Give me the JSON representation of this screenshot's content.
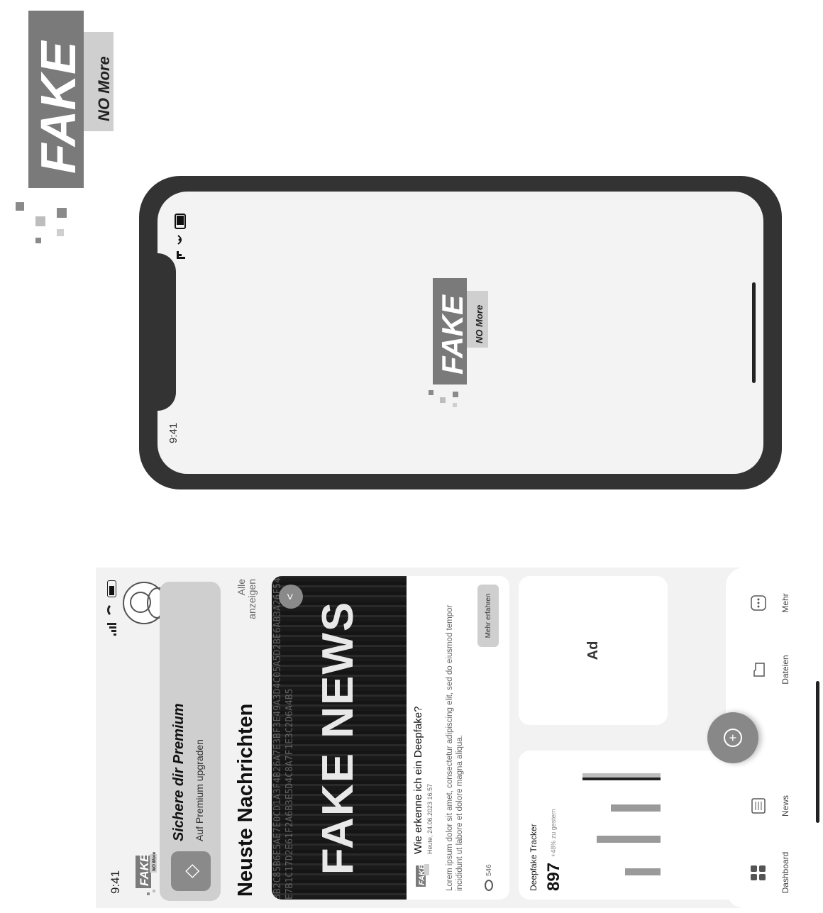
{
  "brand": {
    "word": "FAKE",
    "tagline": "NO More"
  },
  "splash": {
    "time": "9:41"
  },
  "app": {
    "status_time": "9:41",
    "premium": {
      "title": "Sichere dir Premium",
      "subtitle": "Auf Premium upgraden"
    },
    "news_section": {
      "title": "Neuste Nachrichten",
      "see_all": "Alle anzeigen"
    },
    "news_card": {
      "image_text": "FAKE NEWS",
      "heading": "Wie erkenne ich ein Deepfake?",
      "date": "Heute, 24.06.2023 16:57",
      "body": "Lorem ipsum dolor sit amet, consectetur adipiscing elit, sed do eiusmod tempor incididunt ut labore et dolore magna aliqua.",
      "views": "546",
      "cta": "Mehr erfahren"
    },
    "tracker": {
      "title": "Deepfake Tracker",
      "value": "897",
      "change": "+48% zu gestern"
    },
    "ad_label": "Ad",
    "tabs": [
      {
        "label": "Dashboard",
        "icon": "dashboard-icon"
      },
      {
        "label": "News",
        "icon": "newspaper-icon"
      },
      {
        "label": "Dateien",
        "icon": "folder-icon"
      },
      {
        "label": "Mehr",
        "icon": "more-dots-icon"
      }
    ]
  },
  "colors": {
    "dark_frame": "#333333",
    "accent_gray": "#8a8a8a",
    "background": "#f2f2f2"
  }
}
